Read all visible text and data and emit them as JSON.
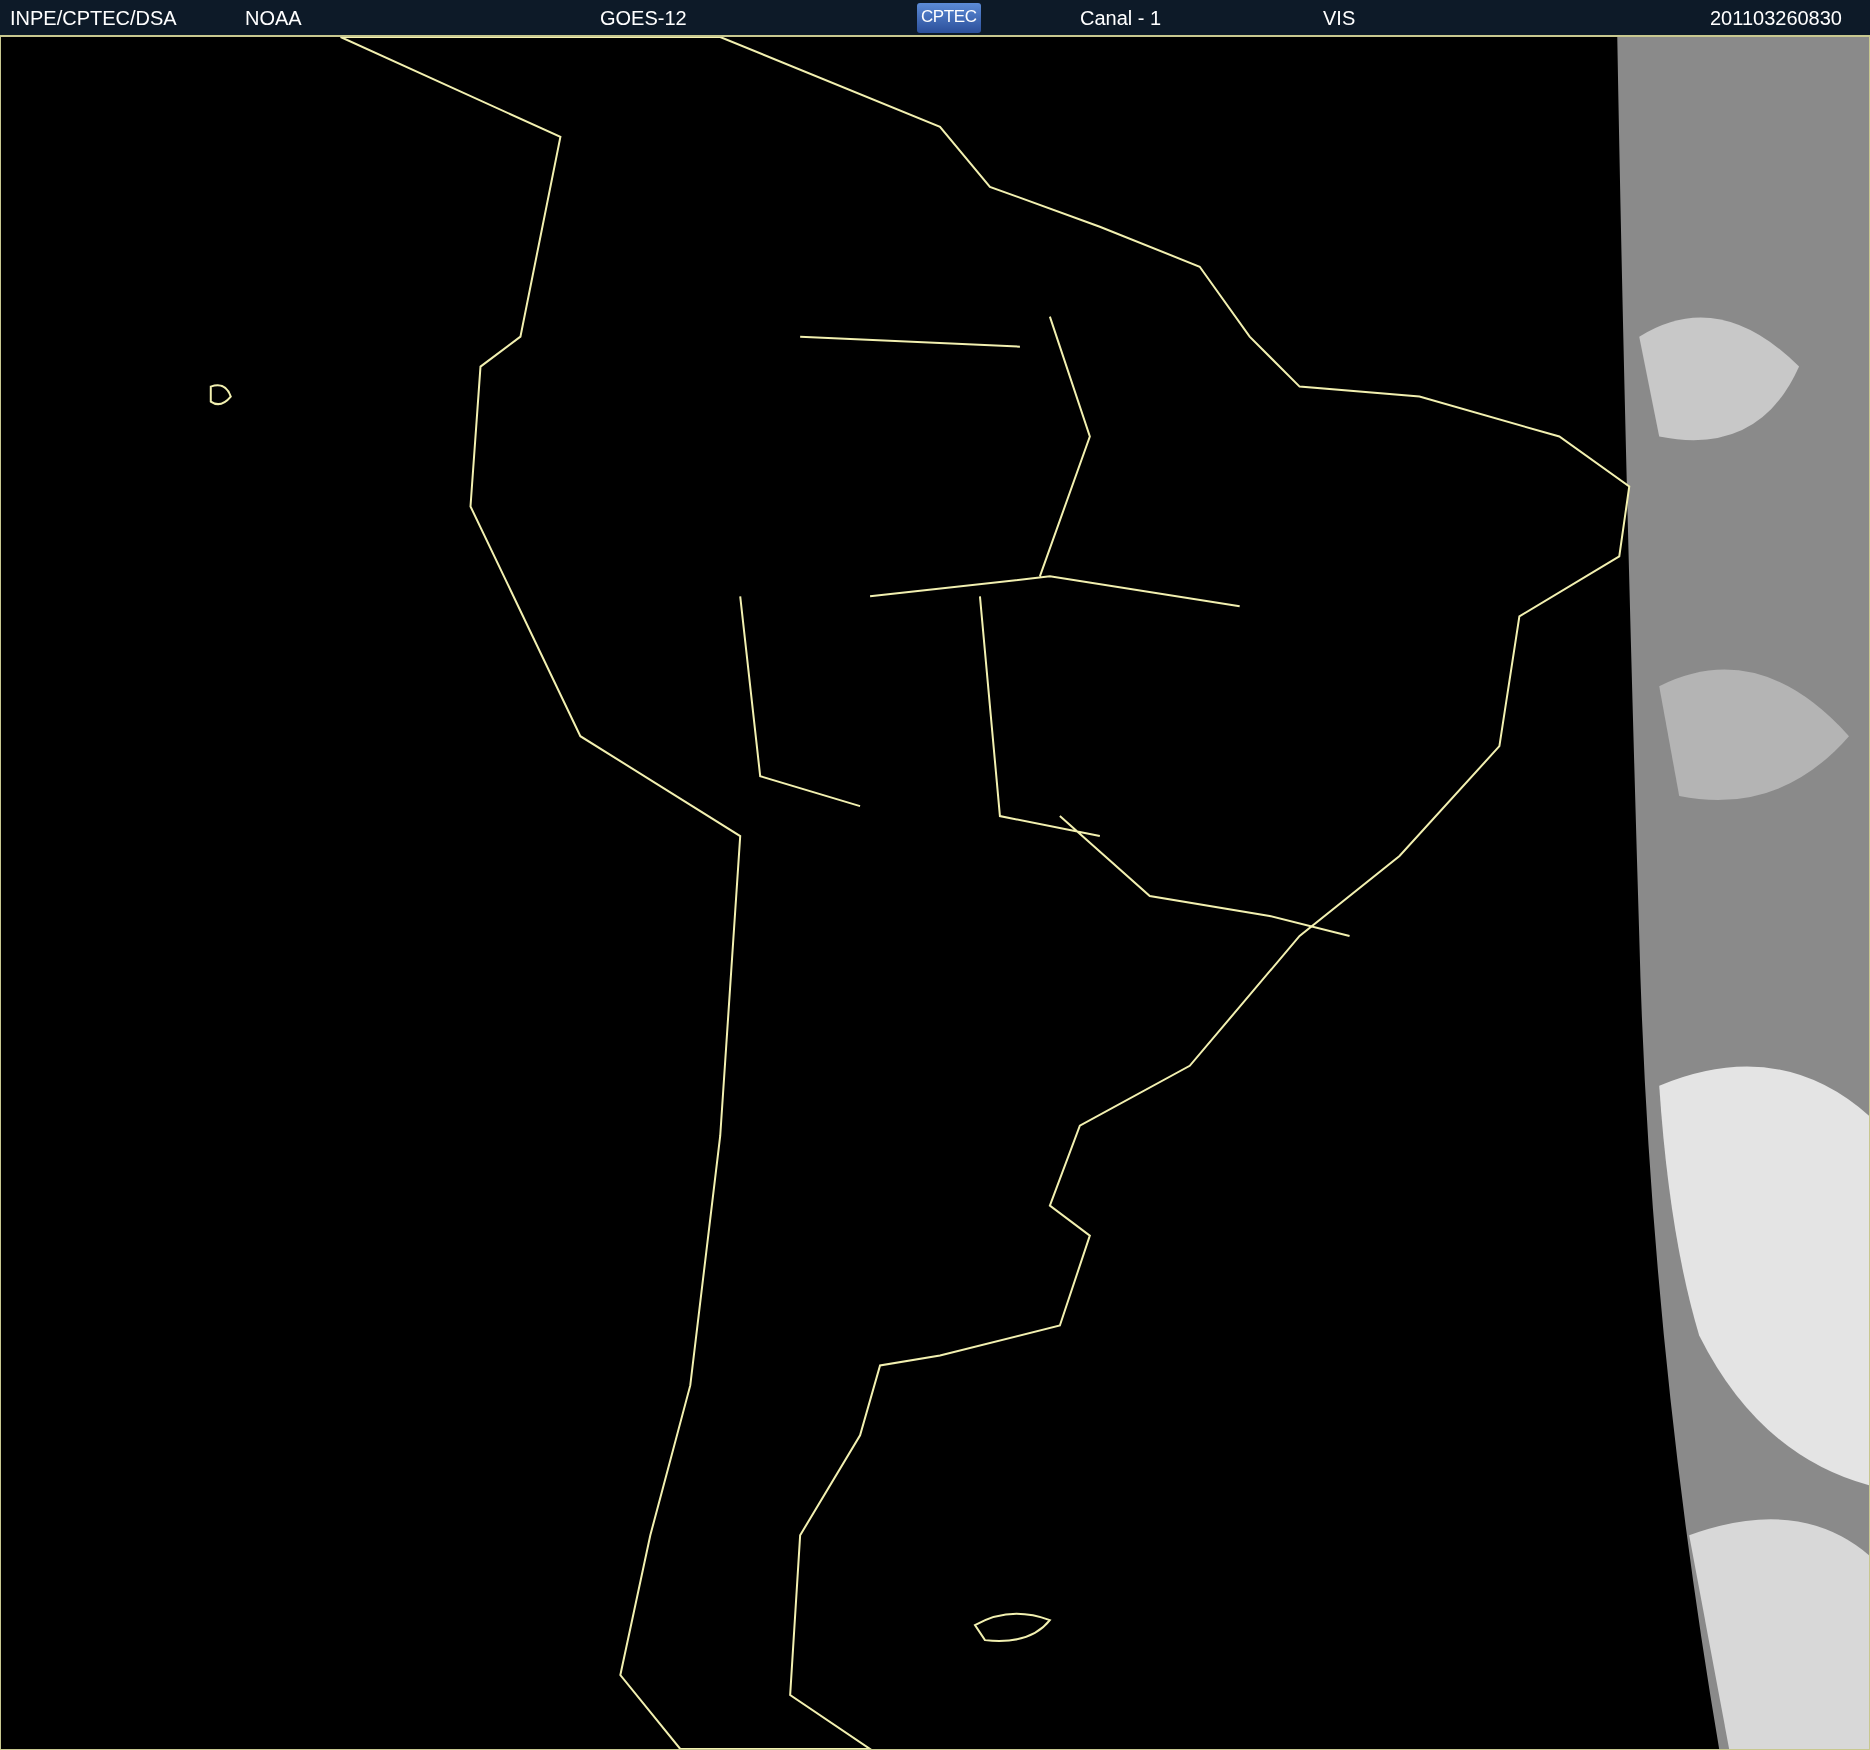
{
  "header": {
    "items": [
      {
        "kind": "text",
        "text": "INPE/CPTEC/DSA"
      },
      {
        "kind": "text",
        "text": "NOAA"
      },
      {
        "kind": "text",
        "text": "GOES-12"
      },
      {
        "kind": "logo",
        "text": "CPTEC"
      },
      {
        "kind": "text",
        "text": "Canal - 1"
      },
      {
        "kind": "text",
        "text": "VIS"
      },
      {
        "kind": "text",
        "text": "201103260830"
      }
    ]
  }
}
